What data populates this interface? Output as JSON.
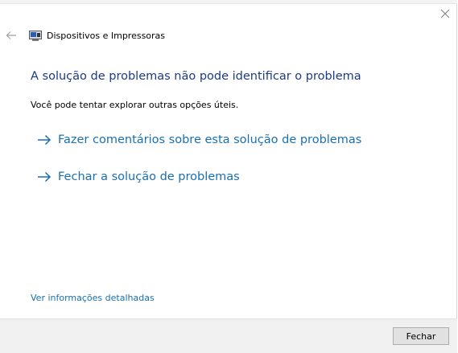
{
  "header": {
    "title": "Dispositivos e Impressoras",
    "icon": "devices-printers-icon"
  },
  "main": {
    "heading": "A solução de problemas não pode identificar o problema",
    "subtext": "Você pode tentar explorar outras opções úteis.",
    "options": [
      {
        "label": "Fazer comentários sobre esta solução de problemas",
        "icon": "arrow-right-icon"
      },
      {
        "label": "Fechar a solução de problemas",
        "icon": "arrow-right-icon"
      }
    ],
    "details_link": "Ver informações detalhadas"
  },
  "footer": {
    "close_label": "Fechar"
  },
  "colors": {
    "heading": "#1a3a8a",
    "link": "#1a6fb0",
    "footer_bg": "#f0f0f0"
  }
}
